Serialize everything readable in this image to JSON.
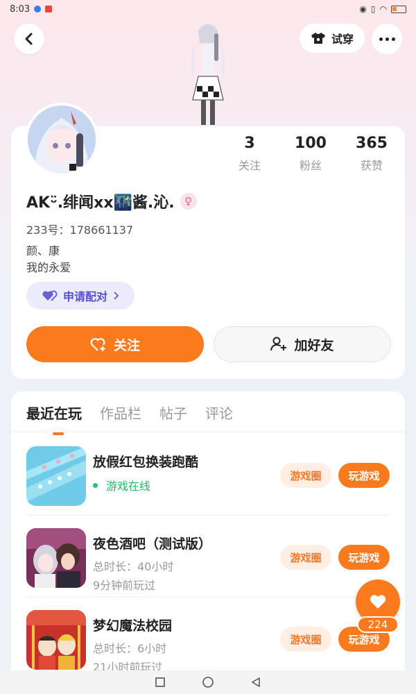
{
  "status_bar": {
    "time": "8:03"
  },
  "header": {
    "tryon_label": "试穿"
  },
  "profile": {
    "stats": [
      {
        "value": "3",
        "label": "关注"
      },
      {
        "value": "100",
        "label": "粉丝"
      },
      {
        "value": "365",
        "label": "获赞"
      }
    ],
    "nickname": "AKᵕ̈.绯闻xx🌃酱.沁.",
    "gender_symbol": "♀",
    "uid": "233号：178661137",
    "bio_line1": "颜、康",
    "bio_line2": "我的永爱",
    "match_label": "申请配对",
    "follow_label": "关注",
    "add_friend_label": "加好友"
  },
  "tabs": [
    "最近在玩",
    "作品栏",
    "帖子",
    "评论"
  ],
  "games": [
    {
      "title": "放假红包换装跑酷",
      "status": "游戏在线",
      "circle_label": "游戏圈",
      "play_label": "玩游戏"
    },
    {
      "title": "夜色酒吧（测试版）",
      "playtime": "总时长：40小时",
      "last_played": "9分钟前玩过",
      "circle_label": "游戏圈",
      "play_label": "玩游戏"
    },
    {
      "title": "梦幻魔法校园",
      "playtime": "总时长：6小时",
      "last_played": "21小时前玩过",
      "circle_label": "游戏圈",
      "play_label": "玩游戏"
    }
  ],
  "likes": {
    "count": "224"
  },
  "colors": {
    "accent": "#fb7a1e",
    "online": "#25b765",
    "match": "#5a50c9"
  }
}
